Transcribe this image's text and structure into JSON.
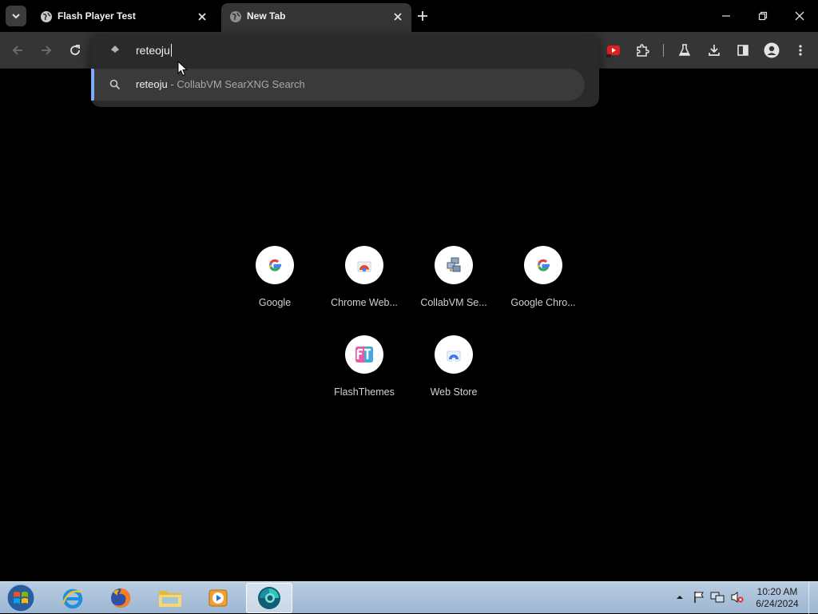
{
  "tabs": [
    {
      "title": "Flash Player Test",
      "favicon": "globe-icon",
      "active": false
    },
    {
      "title": "New Tab",
      "favicon": "globe-icon",
      "active": true
    }
  ],
  "window_controls": [
    "minimize-icon",
    "restore-icon",
    "close-icon"
  ],
  "toolbar": {
    "nav": [
      "back-arrow-icon",
      "forward-arrow-icon",
      "reload-icon"
    ],
    "extensions": [
      "youtube-extension-icon",
      "puzzle-piece-icon",
      "labs-flask-icon",
      "download-icon",
      "side-panel-icon",
      "profile-avatar-icon",
      "kebab-menu-icon"
    ]
  },
  "omnibox": {
    "typed_text": "reteoju",
    "suggestions": [
      {
        "query": "reteoju",
        "separator": "-",
        "engine": "CollabVM SearXNG Search",
        "icon": "search-icon"
      }
    ]
  },
  "shortcuts": [
    {
      "label": "Google",
      "icon": "google-g-icon"
    },
    {
      "label": "Chrome Web...",
      "icon": "chrome-web-store-icon"
    },
    {
      "label": "CollabVM Se...",
      "icon": "collabvm-computers-icon"
    },
    {
      "label": "Google Chro...",
      "icon": "google-g-icon"
    },
    {
      "label": "FlashThemes",
      "icon": "flashthemes-ft-icon"
    },
    {
      "label": "Web Store",
      "icon": "web-store-icon"
    }
  ],
  "taskbar": {
    "apps": [
      "internet-explorer-icon",
      "firefox-icon",
      "file-explorer-icon",
      "media-player-icon",
      "chrome-app-icon"
    ],
    "tray": [
      "show-hidden-icons-icon",
      "action-center-flag-icon",
      "network-icon",
      "volume-muted-icon"
    ],
    "clock": {
      "time": "10:20 AM",
      "date": "6/24/2024"
    }
  },
  "colors": {
    "accent": "#7cacf8",
    "toolbar": "#353535",
    "omnibox_bg": "#2a2a2a",
    "taskbar": "#9db6d1"
  }
}
